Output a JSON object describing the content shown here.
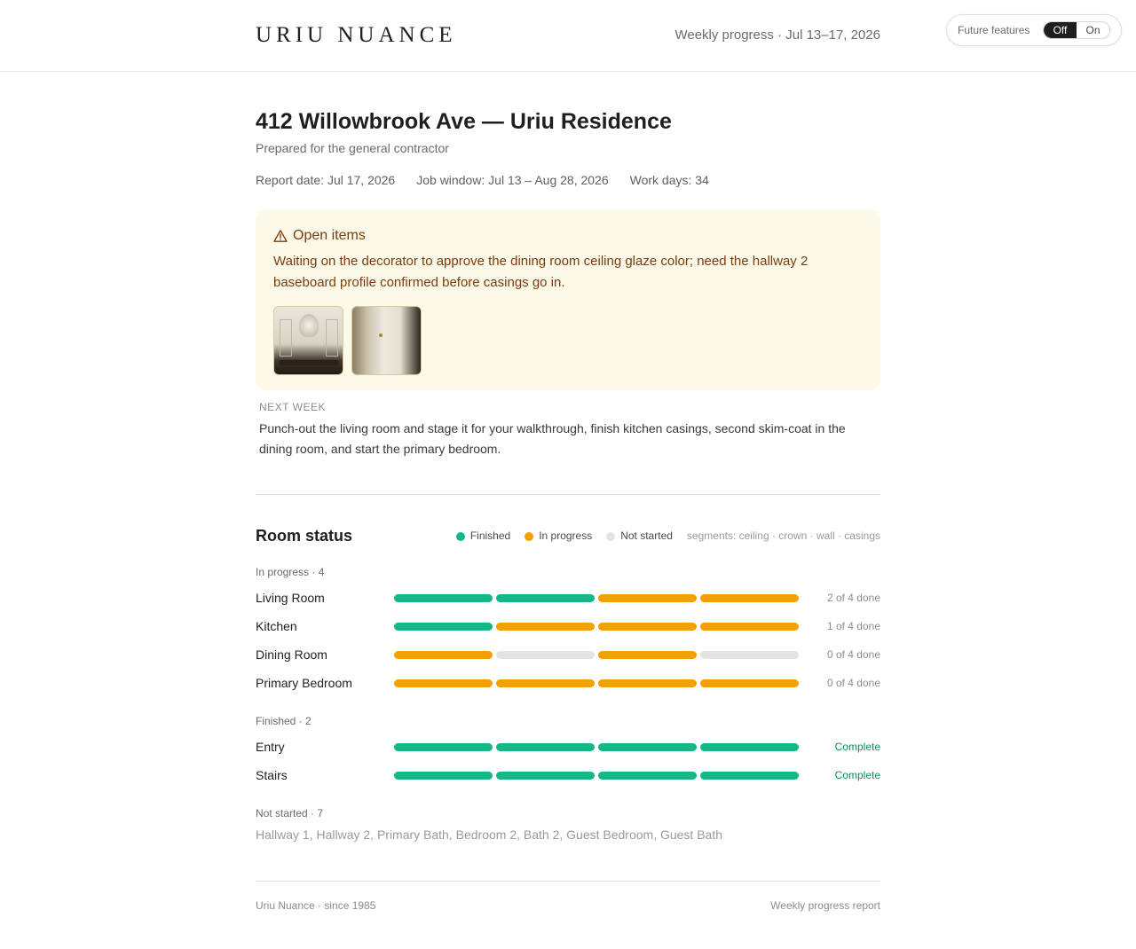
{
  "header": {
    "brand": "URIU NUANCE",
    "week": "Weekly progress · Jul 13–17, 2026",
    "future_features": {
      "label": "Future features",
      "off": "Off",
      "on": "On",
      "selected": "Off"
    }
  },
  "report": {
    "title": "412 Willowbrook Ave — Uriu Residence",
    "subtitle": "Prepared for the general contractor",
    "report_date": "Report date: Jul 17, 2026",
    "job_window": "Job window: Jul 13 – Aug 28, 2026",
    "work_days": "Work days: 34"
  },
  "open_items": {
    "title": "Open items",
    "text": "Waiting on the decorator to approve the dining room ceiling glaze color; need the hallway 2 baseboard profile confirmed before casings go in.",
    "photos": [
      "dining-room-photo",
      "hallway-door-photo"
    ]
  },
  "next_week": {
    "label": "NEXT WEEK",
    "text": "Punch-out the living room and stage it for your walkthrough, finish kitchen casings, second skim-coat in the dining room, and start the primary bedroom."
  },
  "room_status": {
    "title": "Room status",
    "legend": {
      "finished": "Finished",
      "in_progress": "In progress",
      "not_started": "Not started",
      "segments": "segments: ceiling · crown · wall · casings"
    },
    "colors": {
      "finished": "#12b886",
      "in_progress": "#f59f00",
      "not_started": "#e3e3e3"
    },
    "in_progress_label": "In progress · 4",
    "in_progress_rooms": [
      {
        "name": "Living Room",
        "segments": [
          "finished",
          "finished",
          "in_progress",
          "in_progress"
        ],
        "status": "2 of 4 done"
      },
      {
        "name": "Kitchen",
        "segments": [
          "finished",
          "in_progress",
          "in_progress",
          "in_progress"
        ],
        "status": "1 of 4 done"
      },
      {
        "name": "Dining Room",
        "segments": [
          "in_progress",
          "not_started",
          "in_progress",
          "not_started"
        ],
        "status": "0 of 4 done"
      },
      {
        "name": "Primary Bedroom",
        "segments": [
          "in_progress",
          "in_progress",
          "in_progress",
          "in_progress"
        ],
        "status": "0 of 4 done"
      }
    ],
    "finished_label": "Finished · 2",
    "finished_rooms": [
      {
        "name": "Entry",
        "segments": [
          "finished",
          "finished",
          "finished",
          "finished"
        ],
        "status": "Complete"
      },
      {
        "name": "Stairs",
        "segments": [
          "finished",
          "finished",
          "finished",
          "finished"
        ],
        "status": "Complete"
      }
    ],
    "not_started_label": "Not started · 7",
    "not_started_rooms": "Hallway 1, Hallway 2, Primary Bath, Bedroom 2, Bath 2, Guest Bedroom, Guest Bath"
  },
  "footer": {
    "left": "Uriu Nuance · since 1985",
    "right": "Weekly progress report"
  }
}
